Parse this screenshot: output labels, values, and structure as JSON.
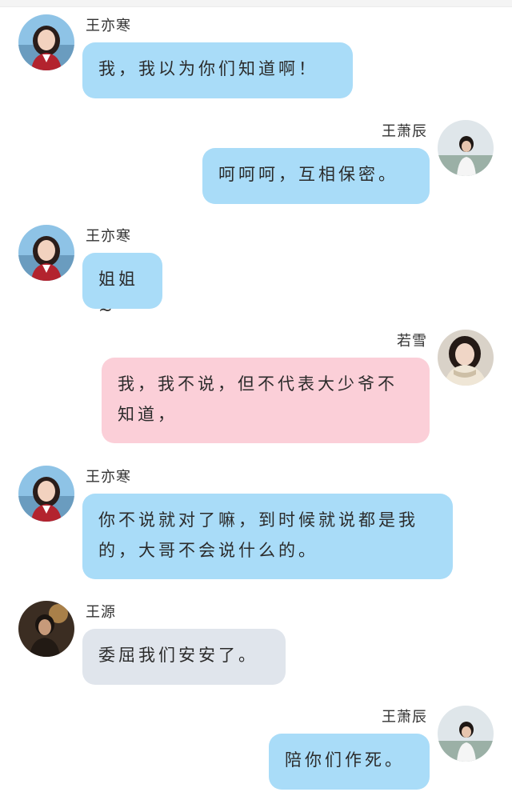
{
  "colors": {
    "bubble_blue": "#a9dcf8",
    "bubble_pink": "#fbcfd8",
    "bubble_gray": "#e0e5ec"
  },
  "messages": [
    {
      "side": "left",
      "sender": "王亦寒",
      "avatar": "girl-red-uniform-avatar",
      "color": "blue",
      "text": "我，我以为你们知道啊！"
    },
    {
      "side": "right",
      "sender": "王萧辰",
      "avatar": "boy-white-shirt-avatar",
      "color": "blue",
      "text": "呵呵呵，互相保密。"
    },
    {
      "side": "left",
      "sender": "王亦寒",
      "avatar": "girl-red-uniform-avatar",
      "color": "blue",
      "text": "姐姐~"
    },
    {
      "side": "right",
      "sender": "若雪",
      "avatar": "girl-scarf-avatar",
      "color": "pink",
      "text": "我，我不说，但不代表大少爷不知道，"
    },
    {
      "side": "left",
      "sender": "王亦寒",
      "avatar": "girl-red-uniform-avatar",
      "color": "blue",
      "text": "你不说就对了嘛，到时候就说都是我的，大哥不会说什么的。"
    },
    {
      "side": "left",
      "sender": "王源",
      "avatar": "boy-stage-light-avatar",
      "color": "gray",
      "text": "委屈我们安安了。"
    },
    {
      "side": "right",
      "sender": "王萧辰",
      "avatar": "boy-white-shirt-avatar",
      "color": "blue",
      "text": "陪你们作死。"
    }
  ]
}
